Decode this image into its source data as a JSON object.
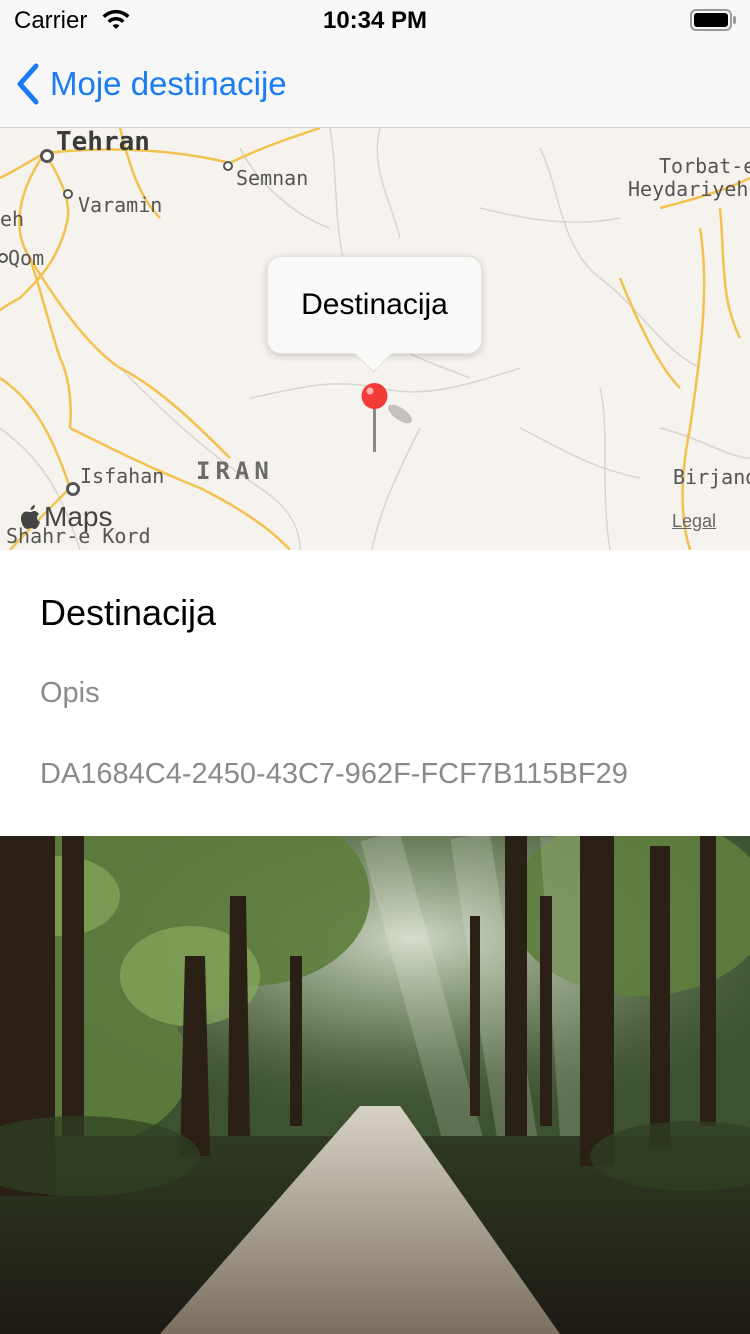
{
  "status_bar": {
    "carrier": "Carrier",
    "time": "10:34 PM",
    "wifi_icon": "wifi-icon",
    "battery_icon": "battery-icon"
  },
  "nav": {
    "back_label": "Moje destinacije",
    "back_icon": "chevron-left-icon",
    "accent_color": "#1a7cf5"
  },
  "map": {
    "labels": {
      "tehran": "Tehran",
      "semnan": "Semnan",
      "varamin": "Varamin",
      "qom": "Qom",
      "partial_left": "eh",
      "torbat_1": "Torbat-e",
      "torbat_2": "Heydariyeh",
      "isfahan": "Isfahan",
      "iran": "IRAN",
      "birjand": "Birjand",
      "shahr_e_kord": "Shahr-e Kord"
    },
    "callout_title": "Destinacija",
    "pin_icon": "map-pin-icon",
    "pin_color": "#f43b37",
    "maps_logo": "Maps",
    "legal": "Legal"
  },
  "details": {
    "title": "Destinacija",
    "description": "Opis",
    "id": "DA1684C4-2450-43C7-962F-FCF7B115BF29"
  },
  "photo": {
    "subject": "forest-road-image"
  }
}
